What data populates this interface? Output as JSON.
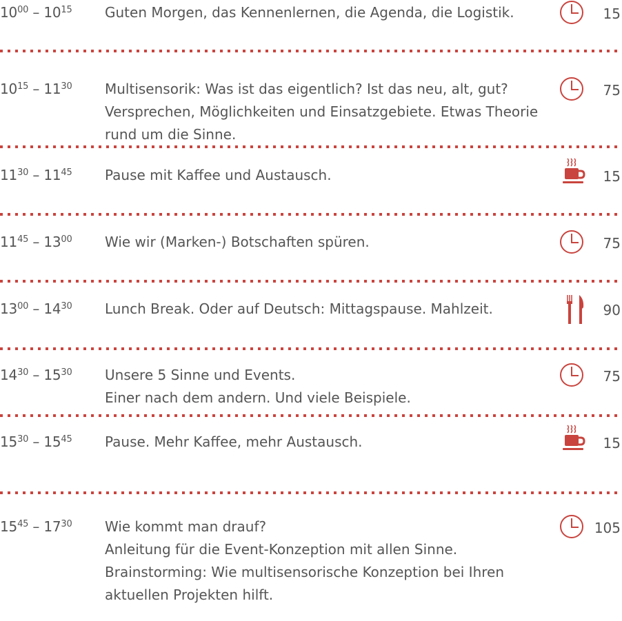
{
  "accent_color": "#c9443e",
  "agenda": [
    {
      "start_h": "10",
      "start_m": "00",
      "end_h": "10",
      "end_m": "15",
      "lines": [
        "Guten Morgen, das Kennenlernen, die Agenda, die Logistik."
      ],
      "icon": "clock-icon",
      "minutes": "15"
    },
    {
      "start_h": "10",
      "start_m": "15",
      "end_h": "11",
      "end_m": "30",
      "lines": [
        "Multisensorik: Was ist das eigentlich? Ist das neu, alt, gut?",
        "Versprechen, Möglichkeiten und Einsatzgebiete. Etwas Theorie",
        "rund um die Sinne."
      ],
      "icon": "clock-icon",
      "minutes": "75"
    },
    {
      "start_h": "11",
      "start_m": "30",
      "end_h": "11",
      "end_m": "45",
      "lines": [
        "Pause mit Kaffee und Austausch."
      ],
      "icon": "coffee-icon",
      "minutes": "15"
    },
    {
      "start_h": "11",
      "start_m": "45",
      "end_h": "13",
      "end_m": "00",
      "lines": [
        "Wie wir (Marken-) Botschaften spüren."
      ],
      "icon": "clock-icon",
      "minutes": "75"
    },
    {
      "start_h": "13",
      "start_m": "00",
      "end_h": "14",
      "end_m": "30",
      "lines": [
        "Lunch Break. Oder auf Deutsch: Mittagspause. Mahlzeit."
      ],
      "icon": "cutlery-icon",
      "minutes": "90"
    },
    {
      "start_h": "14",
      "start_m": "30",
      "end_h": "15",
      "end_m": "30",
      "lines": [
        "Unsere 5 Sinne und Events.",
        "Einer nach dem andern. Und viele Beispiele."
      ],
      "icon": "clock-icon",
      "minutes": "75"
    },
    {
      "start_h": "15",
      "start_m": "30",
      "end_h": "15",
      "end_m": "45",
      "lines": [
        "Pause. Mehr Kaffee, mehr Austausch."
      ],
      "icon": "coffee-icon",
      "minutes": "15"
    },
    {
      "start_h": "15",
      "start_m": "45",
      "end_h": "17",
      "end_m": "30",
      "lines": [
        "Wie kommt man drauf?",
        "Anleitung für die Event-Konzeption mit allen Sinne.",
        "Brainstorming: Wie multisensorische Konzeption bei Ihren",
        "aktuellen Projekten hilft."
      ],
      "icon": "clock-icon",
      "minutes": "105"
    }
  ]
}
